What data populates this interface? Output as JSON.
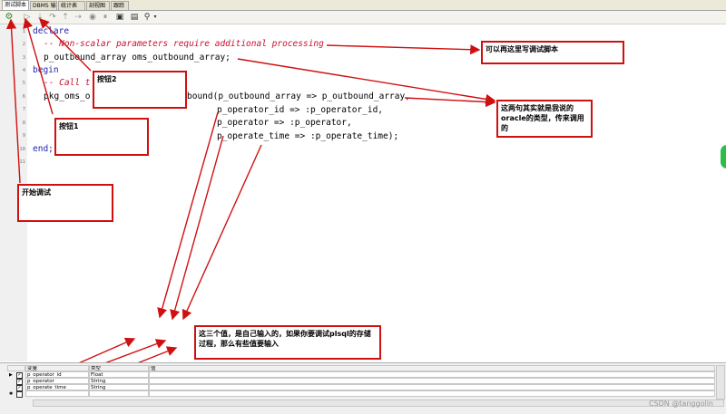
{
  "tabs": [
    "测试脚本",
    "DBMS 输出",
    "统计表",
    "剖视图",
    "跟踪"
  ],
  "line_numbers": [
    "1",
    "2",
    "3",
    "4",
    "5",
    "6",
    "7",
    "8",
    "9",
    "10",
    "11"
  ],
  "code": {
    "line1": "declare",
    "line2": "-- Non-scalar parameters require additional processing",
    "line3": "p_outbound_array oms_outbound_array;",
    "line4": "begin",
    "line5": "-- Call t",
    "line6a": "pkg_oms_o",
    "line6b": "bound(p_outbound_array => p_outbound_array,",
    "line7": "p_operator_id => :p_operator_id,",
    "line8": "p_operator => :p_operator,",
    "line9": "p_operate_time => :p_operate_time);",
    "line10": "end;"
  },
  "notes": {
    "button2": "按钮2",
    "button1": "按钮1",
    "start_debug": "开始调试",
    "rewrite_script": "可以再这里写调试脚本",
    "oracle_type": "这两句其实就是我说的oracle的类型，传来调用的",
    "input_values": "这三个值，是自己输入的，如果你要调试plsql的存储过程，那么有些值要输入"
  },
  "grid": {
    "headers": [
      "变量",
      "类型",
      "值"
    ],
    "rows": [
      {
        "name": "p_operator_id",
        "type": "Float"
      },
      {
        "name": "p_operator",
        "type": "String"
      },
      {
        "name": "p_operate_time",
        "type": "String"
      }
    ]
  },
  "watermark": "CSDN @tanggolin",
  "colors": {
    "annotation": "#d01010",
    "keyword": "#2222aa",
    "comment": "#c8102e"
  }
}
